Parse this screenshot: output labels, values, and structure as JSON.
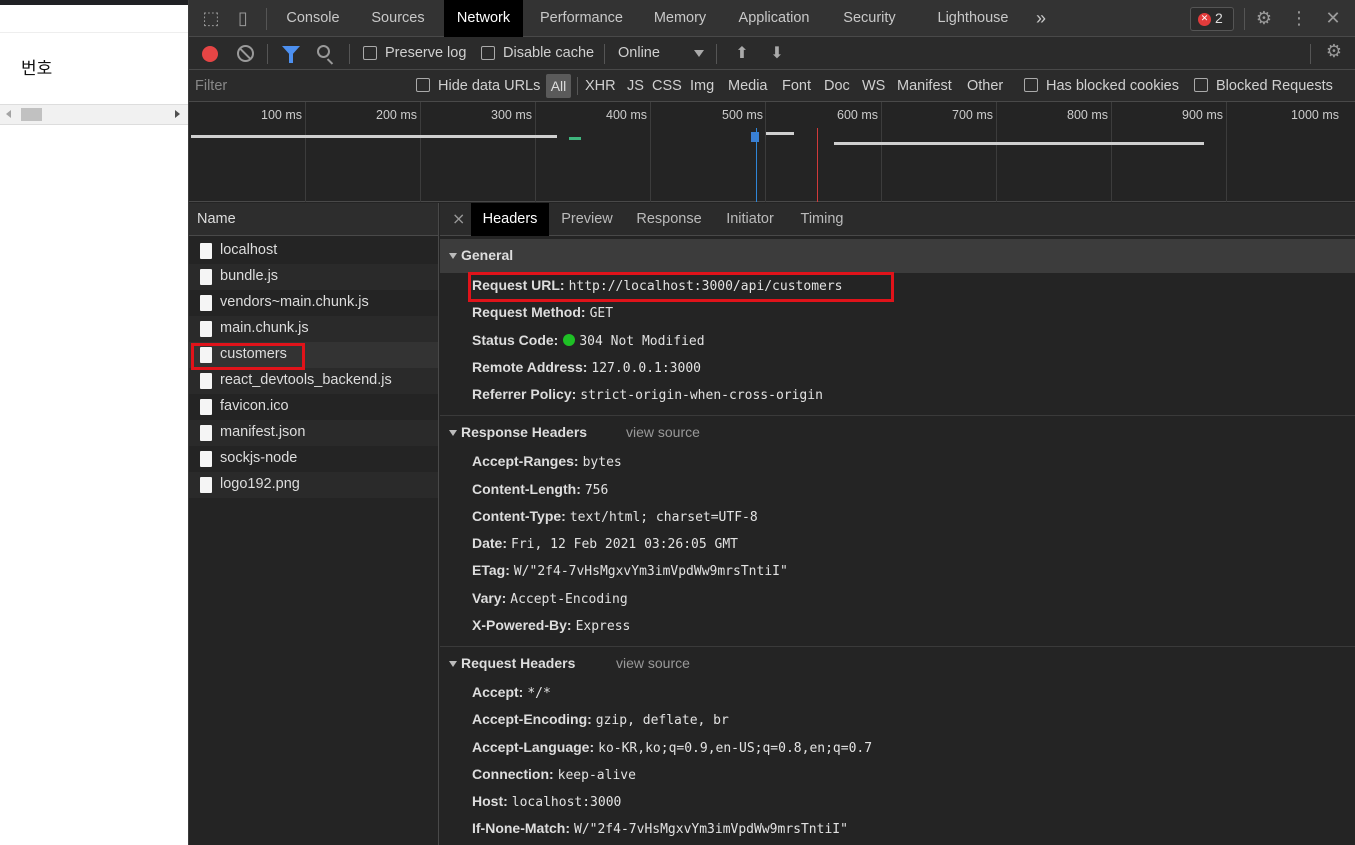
{
  "page": {
    "column_header": "번호"
  },
  "devtools": {
    "tabs": [
      "Console",
      "Sources",
      "Network",
      "Performance",
      "Memory",
      "Application",
      "Security",
      "Lighthouse"
    ],
    "more_tabs_glyph": "»",
    "error_count": "2",
    "toolbar": {
      "preserve_log": "Preserve log",
      "disable_cache": "Disable cache",
      "throttling": "Online"
    },
    "filterbar": {
      "placeholder": "Filter",
      "hide_data_urls": "Hide data URLs",
      "all": "All",
      "types": [
        "XHR",
        "JS",
        "CSS",
        "Img",
        "Media",
        "Font",
        "Doc",
        "WS",
        "Manifest",
        "Other"
      ],
      "has_blocked_cookies": "Has blocked cookies",
      "blocked_requests": "Blocked Requests"
    },
    "timeline_labels": [
      "100 ms",
      "200 ms",
      "300 ms",
      "400 ms",
      "500 ms",
      "600 ms",
      "700 ms",
      "800 ms",
      "900 ms",
      "1000 ms"
    ],
    "colors": {
      "accent": "#4d90f0",
      "record": "#e54545",
      "highlight": "#e0131a",
      "status_ok": "#1ec025"
    }
  },
  "requests": {
    "header": "Name",
    "items": [
      "localhost",
      "bundle.js",
      "vendors~main.chunk.js",
      "main.chunk.js",
      "customers",
      "react_devtools_backend.js",
      "favicon.ico",
      "manifest.json",
      "sockjs-node",
      "logo192.png"
    ],
    "selected": "customers"
  },
  "details": {
    "tabs": [
      "Headers",
      "Preview",
      "Response",
      "Initiator",
      "Timing"
    ],
    "general": {
      "title": "General",
      "rows": [
        {
          "k": "Request URL:",
          "v": "http://localhost:3000/api/customers"
        },
        {
          "k": "Request Method:",
          "v": "GET"
        },
        {
          "k": "Status Code:",
          "v": "304 Not Modified"
        },
        {
          "k": "Remote Address:",
          "v": "127.0.0.1:3000"
        },
        {
          "k": "Referrer Policy:",
          "v": "strict-origin-when-cross-origin"
        }
      ]
    },
    "response_headers": {
      "title": "Response Headers",
      "view_source": "view source",
      "rows": [
        {
          "k": "Accept-Ranges:",
          "v": "bytes"
        },
        {
          "k": "Content-Length:",
          "v": "756"
        },
        {
          "k": "Content-Type:",
          "v": "text/html; charset=UTF-8"
        },
        {
          "k": "Date:",
          "v": "Fri, 12 Feb 2021 03:26:05 GMT"
        },
        {
          "k": "ETag:",
          "v": "W/\"2f4-7vHsMgxvYm3imVpdWw9mrsTntiI\""
        },
        {
          "k": "Vary:",
          "v": "Accept-Encoding"
        },
        {
          "k": "X-Powered-By:",
          "v": "Express"
        }
      ]
    },
    "request_headers": {
      "title": "Request Headers",
      "view_source": "view source",
      "rows": [
        {
          "k": "Accept:",
          "v": "*/*"
        },
        {
          "k": "Accept-Encoding:",
          "v": "gzip, deflate, br"
        },
        {
          "k": "Accept-Language:",
          "v": "ko-KR,ko;q=0.9,en-US;q=0.8,en;q=0.7"
        },
        {
          "k": "Connection:",
          "v": "keep-alive"
        },
        {
          "k": "Host:",
          "v": "localhost:3000"
        },
        {
          "k": "If-None-Match:",
          "v": "W/\"2f4-7vHsMgxvYm3imVpdWw9mrsTntiI\""
        }
      ]
    }
  }
}
